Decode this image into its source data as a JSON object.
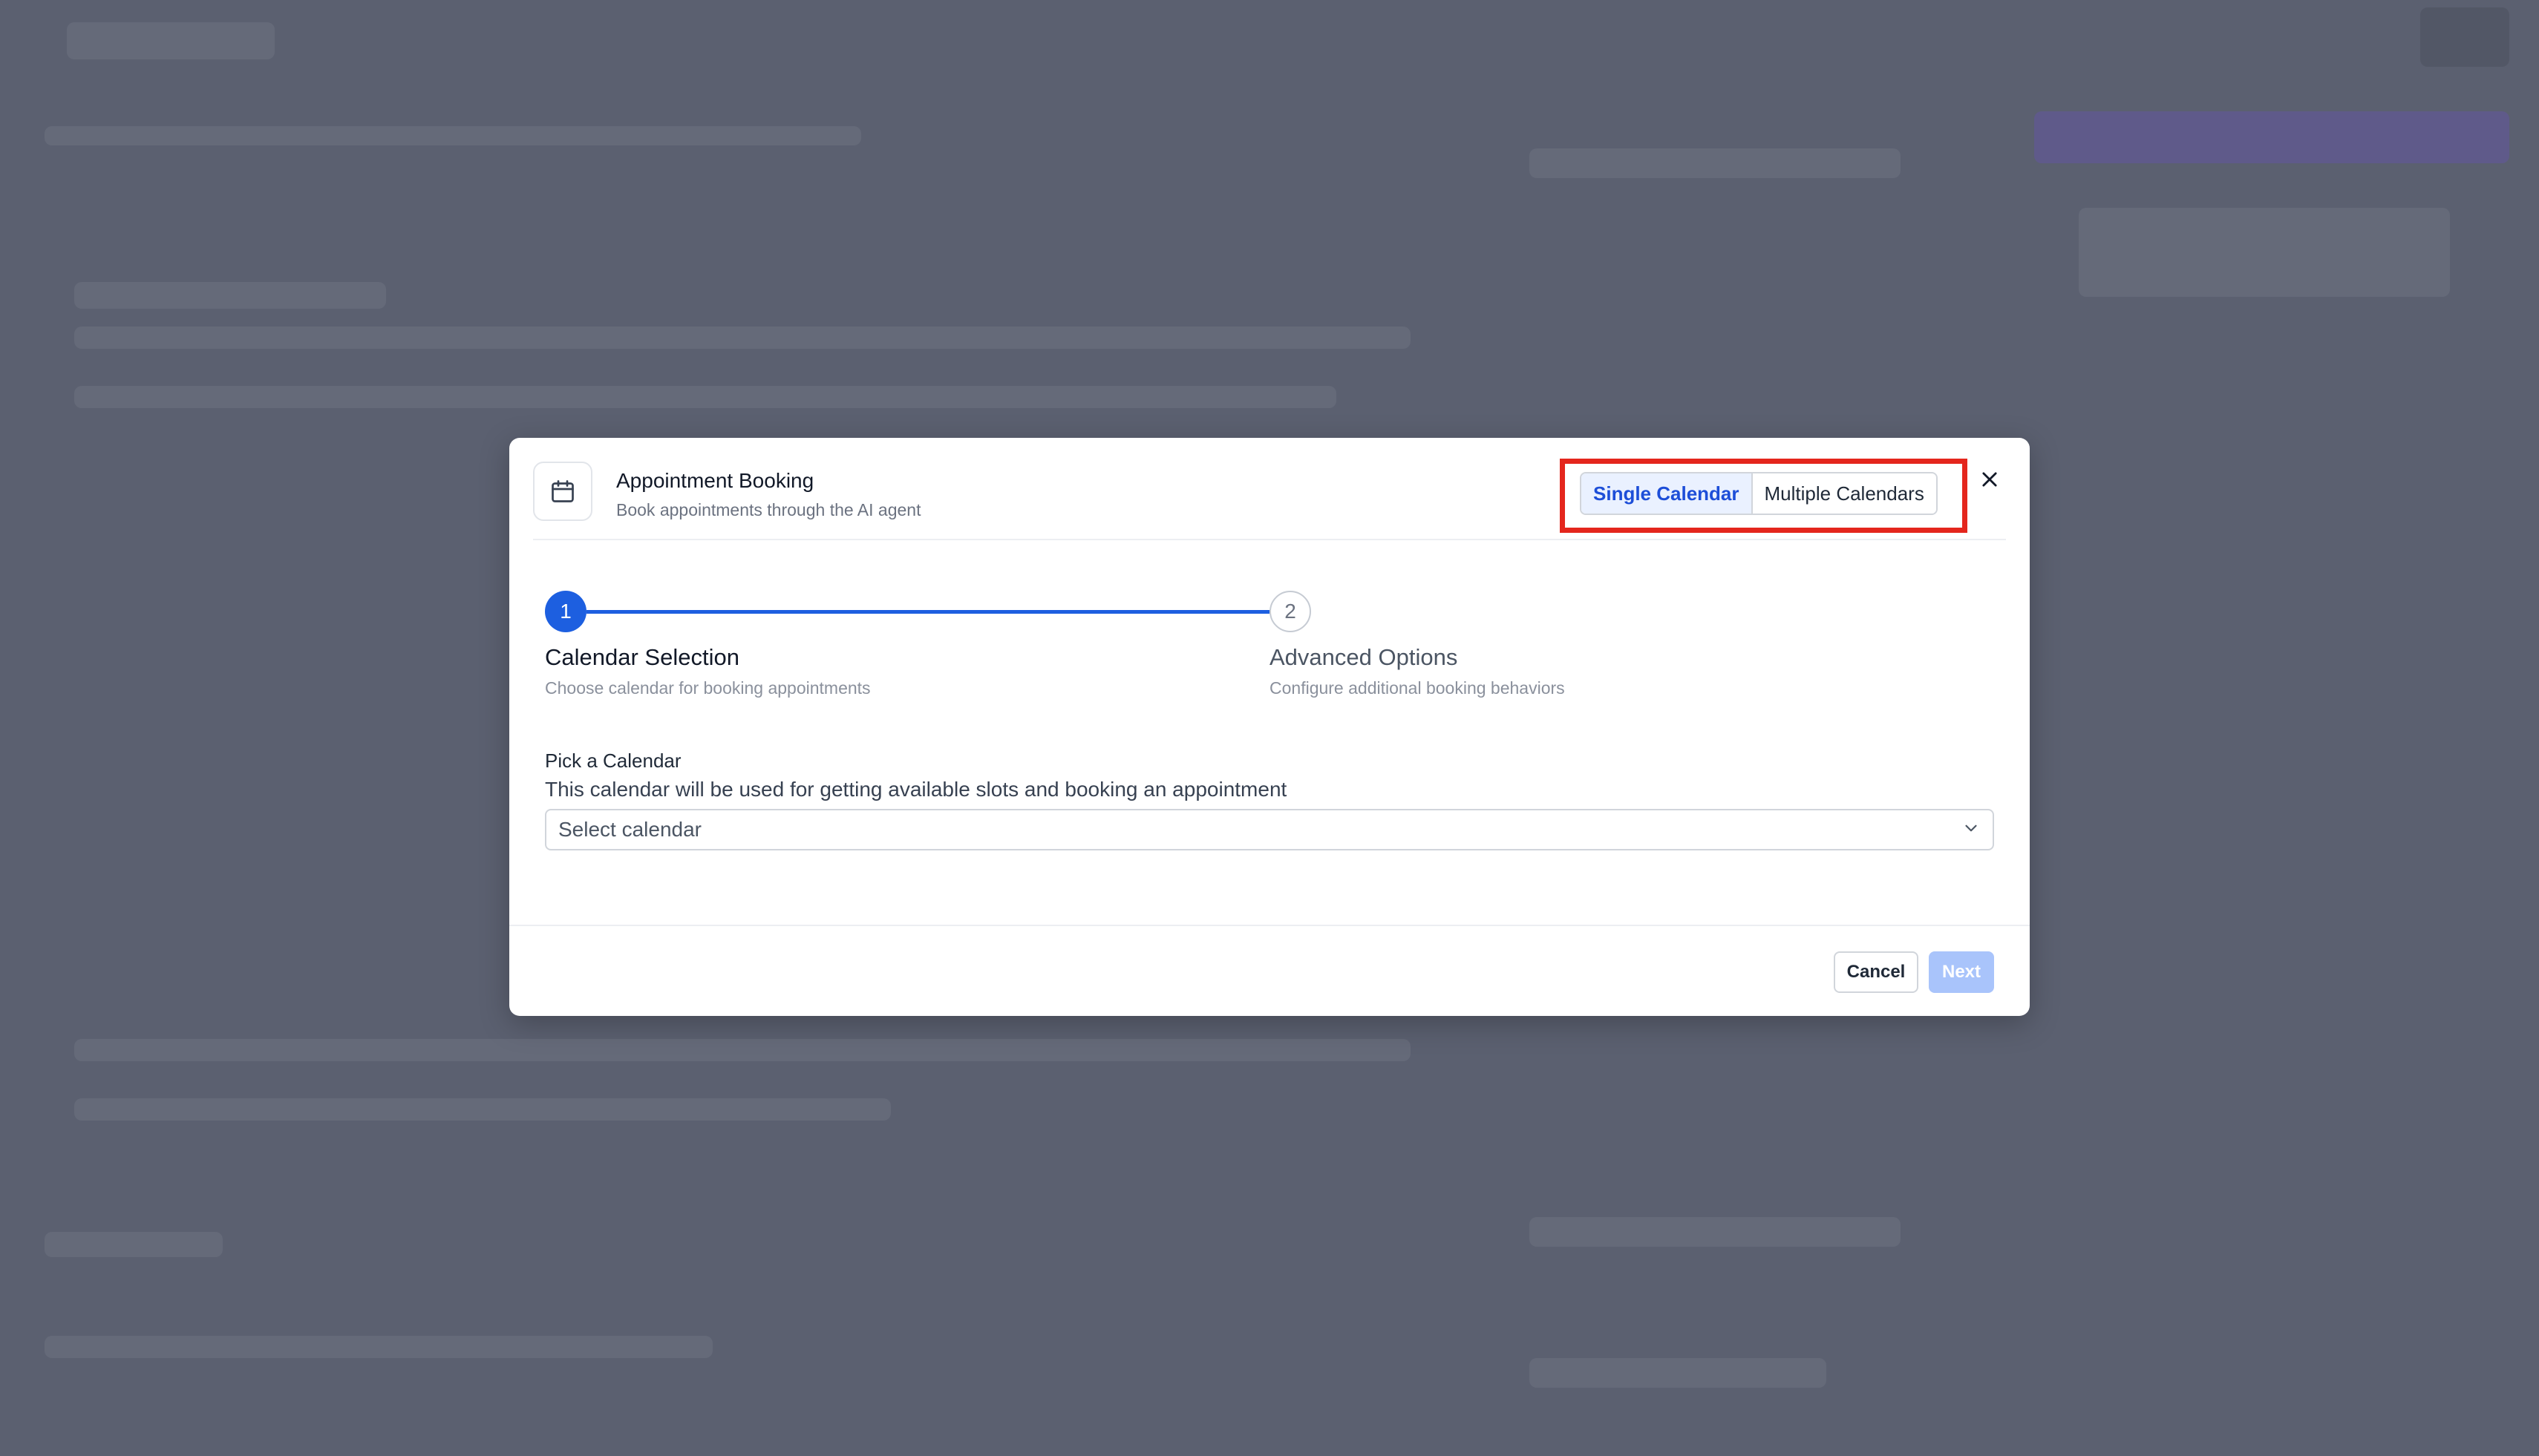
{
  "modal": {
    "title": "Appointment Booking",
    "subtitle": "Book appointments through the AI agent",
    "icon": "calendar-icon",
    "mode_toggle": {
      "options": [
        "Single Calendar",
        "Multiple Calendars"
      ],
      "selected": "Single Calendar"
    },
    "close_icon": "close-icon"
  },
  "steps": [
    {
      "number": "1",
      "title": "Calendar Selection",
      "description": "Choose calendar for booking appointments",
      "state": "active"
    },
    {
      "number": "2",
      "title": "Advanced Options",
      "description": "Configure additional booking behaviors",
      "state": "inactive"
    }
  ],
  "calendar_field": {
    "label": "Pick a Calendar",
    "help": "This calendar will be used for getting available slots and booking an appointment",
    "placeholder": "Select calendar",
    "value": ""
  },
  "footer": {
    "cancel_label": "Cancel",
    "next_label": "Next",
    "next_disabled": true
  },
  "colors": {
    "accent": "#1d5fe0",
    "highlight_border": "#e4261d",
    "overlay": "#5b6070"
  }
}
